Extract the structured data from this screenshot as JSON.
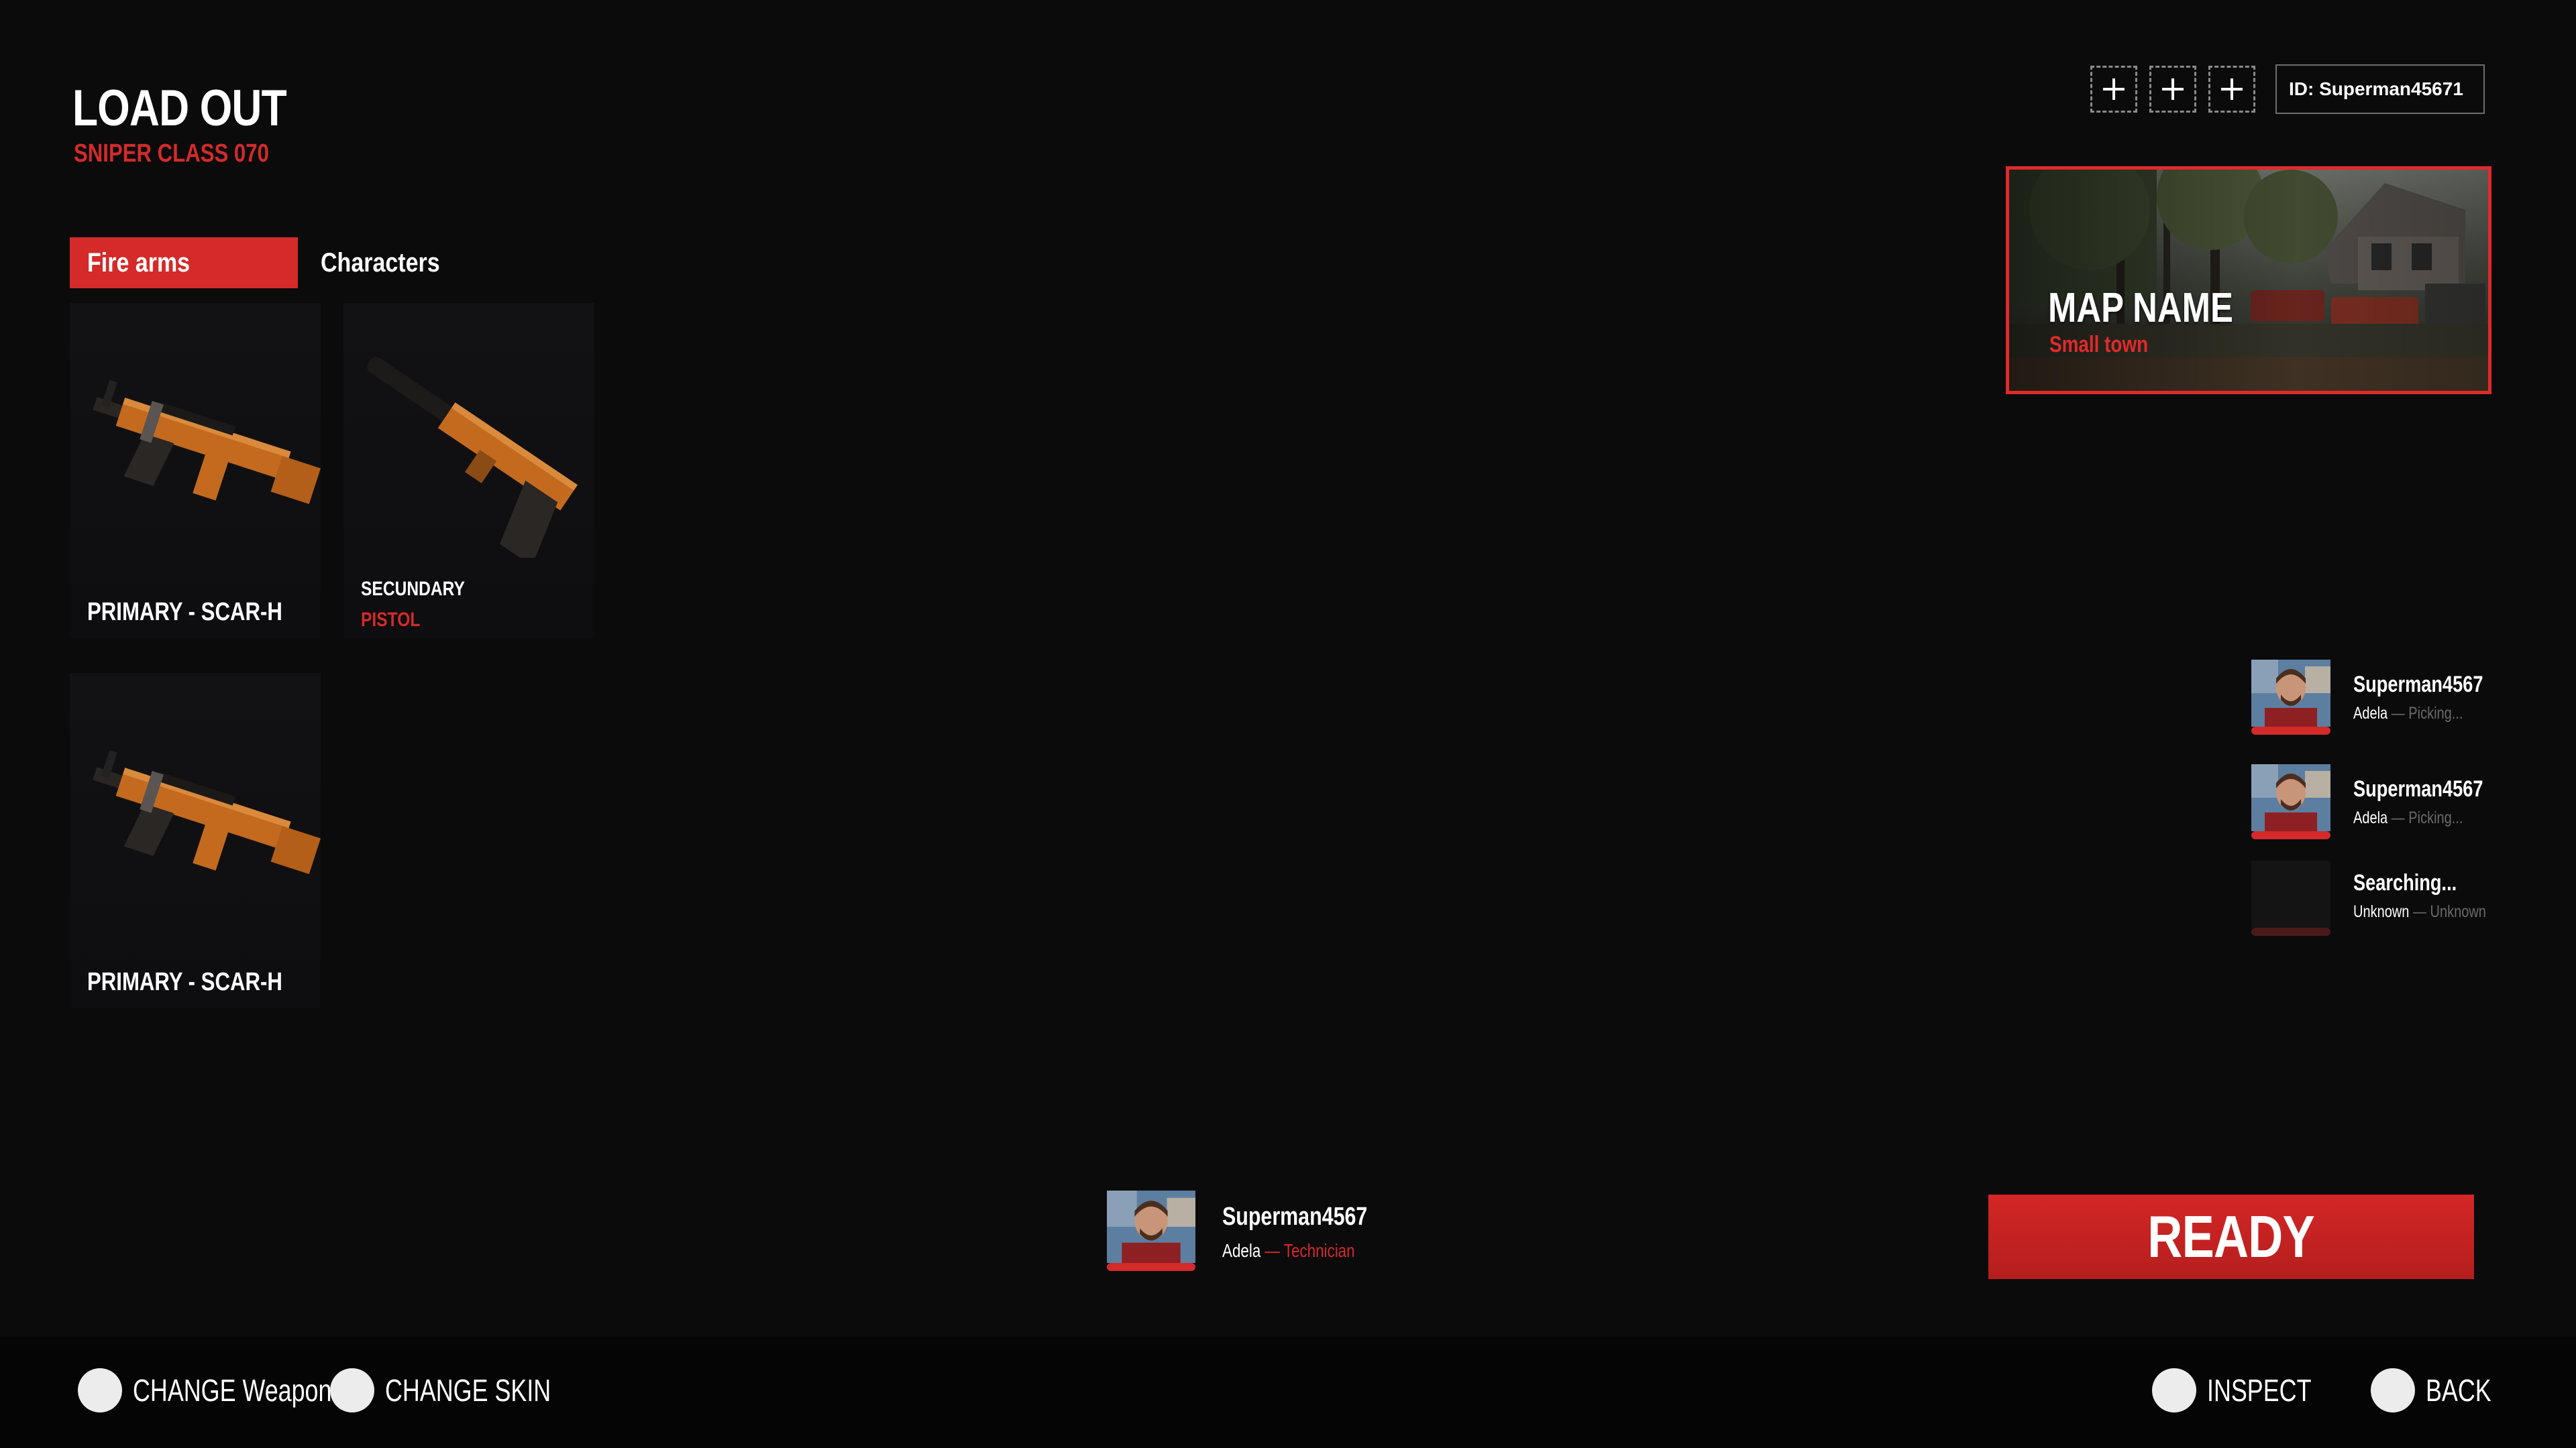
{
  "header": {
    "title": "LOAD OUT",
    "subtitle": "SNIPER CLASS 070"
  },
  "tabs": [
    {
      "label": "Fire arms",
      "active": true
    },
    {
      "label": "Characters",
      "active": false
    }
  ],
  "weapons": [
    {
      "label": "PRIMARY - SCAR-H",
      "icon": "scar-h-rifle-icon"
    },
    {
      "label": "SECUNDARY",
      "sublabel": "PISTOL",
      "icon": "pistol-icon"
    },
    {
      "label": "PRIMARY - SCAR-H",
      "icon": "scar-h-rifle-icon"
    }
  ],
  "top_right": {
    "invite_slots": [
      "+",
      "+",
      "+"
    ],
    "player_id": "ID: Superman45671"
  },
  "map": {
    "name": "MAP NAME",
    "subtitle": "Small town"
  },
  "party": [
    {
      "name": "Superman4567",
      "character": "Adela",
      "separator": "—",
      "status": "Picking..."
    },
    {
      "name": "Superman4567",
      "character": "Adela",
      "separator": "—",
      "status": "Picking..."
    },
    {
      "name": "Searching...",
      "character": "Unknown",
      "separator": "—",
      "status": "Unknown"
    }
  ],
  "player": {
    "name": "Superman4567",
    "character": "Adela",
    "separator": "—",
    "role": "Technician"
  },
  "ready_label": "READY",
  "hints": {
    "change_weapon": "CHANGE Weapon",
    "change_skin": "CHANGE SKIN",
    "inspect": "INSPECT",
    "back": "BACK"
  },
  "colors": {
    "accent": "#d42a2a",
    "background": "#0b0b0c",
    "weapon_orange": "#c46a1e"
  }
}
